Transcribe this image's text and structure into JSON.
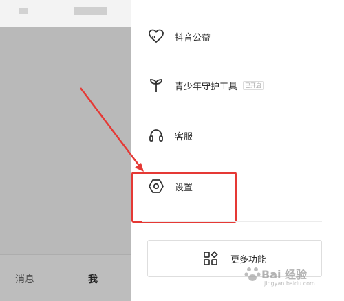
{
  "tabbar": {
    "messages_label": "消息",
    "me_label": "我"
  },
  "menu": {
    "items": [
      {
        "label": "抖音公益",
        "icon": "heart-charity-icon"
      },
      {
        "label": "青少年守护工具",
        "icon": "sprout-icon",
        "badge": "已开启"
      },
      {
        "label": "客服",
        "icon": "headset-icon"
      },
      {
        "label": "设置",
        "icon": "settings-hex-icon"
      }
    ]
  },
  "more_button": {
    "label": "更多功能",
    "icon": "grid-apps-icon"
  },
  "annotation": {
    "color": "#e53935"
  },
  "watermark": {
    "text": "Bai  经验",
    "sub": "jingyan.baidu.com"
  }
}
